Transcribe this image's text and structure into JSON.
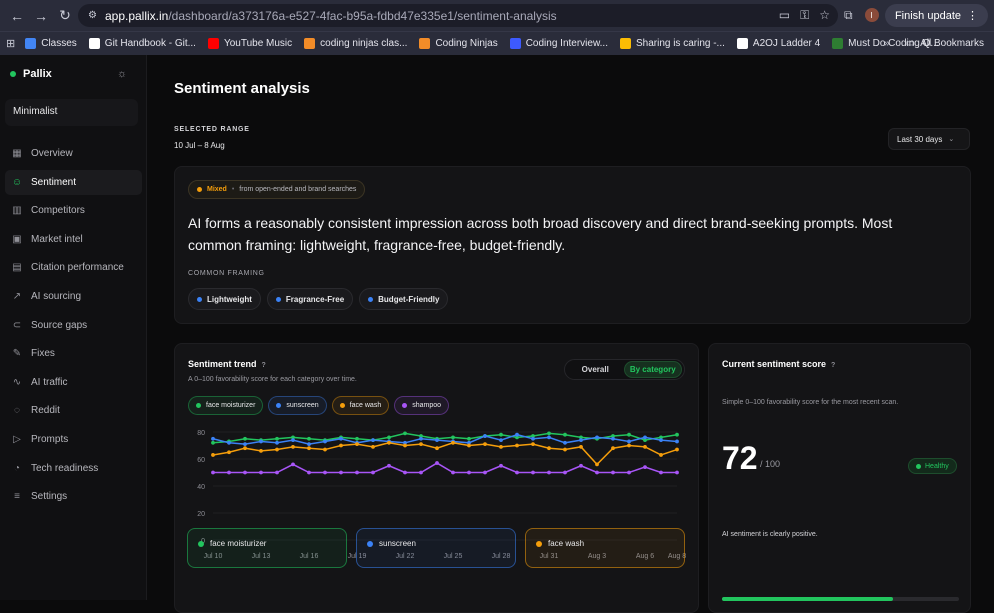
{
  "browser": {
    "url_host": "app.pallix.in",
    "url_path": "/dashboard/a373176a-e527-4fac-b95a-fdbd47e335e1/sentiment-analysis",
    "finish_update": "Finish update",
    "avatar_letter": "I",
    "bookmarks": [
      {
        "label": "Classes",
        "color": "#4285f4"
      },
      {
        "label": "Git Handbook - Git...",
        "color": "#ffffff"
      },
      {
        "label": "YouTube Music",
        "color": "#ff0000"
      },
      {
        "label": "coding ninjas clas...",
        "color": "#f28c28"
      },
      {
        "label": "Coding Ninjas",
        "color": "#f28c28"
      },
      {
        "label": "Coding Interview...",
        "color": "#3d5afe"
      },
      {
        "label": "Sharing is caring -...",
        "color": "#fbbc04"
      },
      {
        "label": "A2OJ Ladder 4",
        "color": "#ffffff"
      },
      {
        "label": "Must Do Coding Q...",
        "color": "#2e7d32"
      }
    ],
    "all_bookmarks": "All Bookmarks"
  },
  "sidebar": {
    "brand": "Pallix",
    "workspace": "Minimalist",
    "items": [
      {
        "label": "Overview",
        "icon": "grid-icon",
        "glyph": "▦"
      },
      {
        "label": "Sentiment",
        "icon": "smile-icon",
        "glyph": "☺"
      },
      {
        "label": "Competitors",
        "icon": "bar-chart-icon",
        "glyph": "▥"
      },
      {
        "label": "Market intel",
        "icon": "window-icon",
        "glyph": "▣"
      },
      {
        "label": "Citation performance",
        "icon": "document-icon",
        "glyph": "▤"
      },
      {
        "label": "AI sourcing",
        "icon": "trend-icon",
        "glyph": "↗"
      },
      {
        "label": "Source gaps",
        "icon": "link-icon",
        "glyph": "⊂"
      },
      {
        "label": "Fixes",
        "icon": "wrench-icon",
        "glyph": "✎"
      },
      {
        "label": "AI traffic",
        "icon": "activity-icon",
        "glyph": "∿"
      },
      {
        "label": "Reddit",
        "icon": "chat-icon",
        "glyph": "◌"
      },
      {
        "label": "Prompts",
        "icon": "terminal-icon",
        "glyph": "▷"
      },
      {
        "label": "Tech readiness",
        "icon": "gauge-icon",
        "glyph": "◔"
      },
      {
        "label": "Settings",
        "icon": "sliders-icon",
        "glyph": "≡"
      }
    ]
  },
  "page": {
    "title": "Sentiment analysis",
    "range_label": "SELECTED RANGE",
    "range_value": "10 Jul – 8 Aug",
    "range_select": "Last 30 days"
  },
  "summary": {
    "badge": "Mixed",
    "badge_note": "from open-ended and brand searches",
    "headline": "AI forms a reasonably consistent impression across both broad discovery and direct brand-seeking prompts. Most common framing: lightweight, fragrance-free, budget-friendly.",
    "framing_label": "COMMON FRAMING",
    "tags": [
      "Lightweight",
      "Fragrance-Free",
      "Budget-Friendly"
    ]
  },
  "trend": {
    "title": "Sentiment trend",
    "help": "?",
    "subtitle": "A 0–100 favorability score for each category over time.",
    "tabs": [
      "Overall",
      "By category"
    ]
  },
  "score": {
    "title": "Current sentiment score",
    "help": "?",
    "subtitle": "Simple 0–100 favorability score for the most recent scan.",
    "value": "72",
    "max": "/ 100",
    "status": "Healthy",
    "note": "AI sentiment is clearly positive.",
    "fraction": 0.72
  },
  "bottom_cards": [
    {
      "label": "face moisturizer",
      "color": "#22c55e"
    },
    {
      "label": "sunscreen",
      "color": "#3b82f6"
    },
    {
      "label": "face wash",
      "color": "#f59e0b"
    }
  ],
  "chart_data": {
    "type": "line",
    "x": [
      "Jul 10",
      "Jul 11",
      "Jul 12",
      "Jul 13",
      "Jul 14",
      "Jul 15",
      "Jul 16",
      "Jul 17",
      "Jul 18",
      "Jul 19",
      "Jul 20",
      "Jul 21",
      "Jul 22",
      "Jul 23",
      "Jul 24",
      "Jul 25",
      "Jul 26",
      "Jul 27",
      "Jul 28",
      "Jul 29",
      "Jul 30",
      "Jul 31",
      "Aug 1",
      "Aug 2",
      "Aug 3",
      "Aug 4",
      "Aug 5",
      "Aug 6",
      "Aug 7",
      "Aug 8"
    ],
    "xticks": [
      "Jul 10",
      "Jul 13",
      "Jul 16",
      "Jul 19",
      "Jul 22",
      "Jul 25",
      "Jul 28",
      "Jul 31",
      "Aug 3",
      "Aug 6",
      "Aug 8"
    ],
    "yticks": [
      0,
      20,
      40,
      60,
      80
    ],
    "ylim": [
      0,
      80
    ],
    "series": [
      {
        "name": "face moisturizer",
        "color": "#22c55e",
        "values": [
          72,
          73,
          75,
          74,
          75,
          76,
          75,
          74,
          76,
          75,
          74,
          76,
          79,
          77,
          75,
          76,
          75,
          77,
          78,
          76,
          77,
          79,
          78,
          76,
          75,
          77,
          78,
          74,
          76,
          78
        ]
      },
      {
        "name": "sunscreen",
        "color": "#3b82f6",
        "values": [
          75,
          72,
          71,
          73,
          72,
          74,
          71,
          73,
          75,
          72,
          74,
          73,
          72,
          75,
          74,
          73,
          72,
          77,
          74,
          78,
          75,
          76,
          72,
          74,
          76,
          75,
          73,
          76,
          74,
          73
        ]
      },
      {
        "name": "face wash",
        "color": "#f59e0b",
        "values": [
          63,
          65,
          68,
          66,
          67,
          69,
          68,
          67,
          70,
          71,
          69,
          72,
          70,
          71,
          68,
          72,
          70,
          71,
          69,
          70,
          71,
          68,
          67,
          69,
          56,
          68,
          70,
          69,
          63,
          67
        ]
      },
      {
        "name": "shampoo",
        "color": "#a855f7",
        "values": [
          50,
          50,
          50,
          50,
          50,
          56,
          50,
          50,
          50,
          50,
          50,
          55,
          50,
          50,
          57,
          50,
          50,
          50,
          55,
          50,
          50,
          50,
          50,
          55,
          50,
          50,
          50,
          54,
          50,
          50
        ]
      }
    ]
  }
}
